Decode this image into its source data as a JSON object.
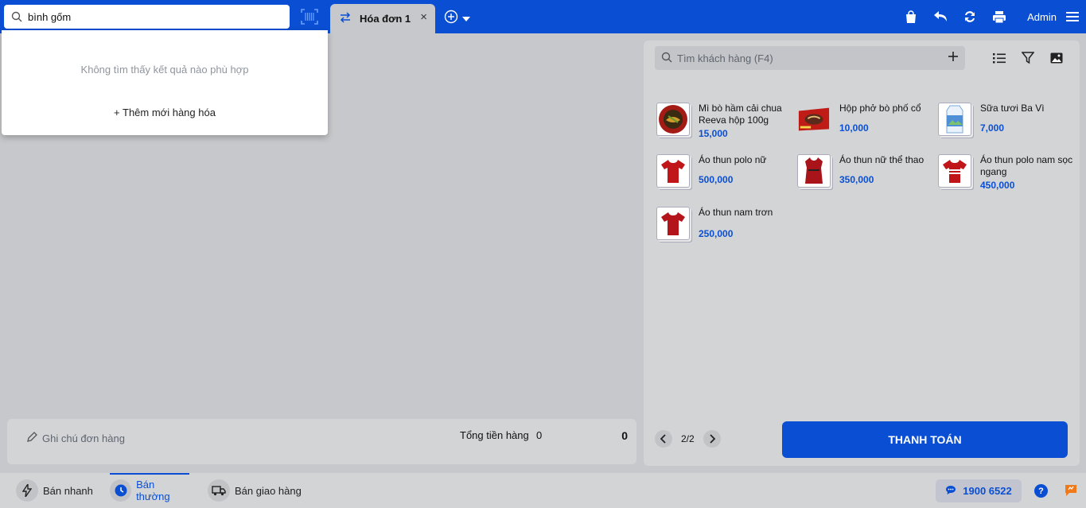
{
  "search": {
    "value": "bình gốm",
    "placeholder": ""
  },
  "tabs": [
    {
      "label": "Hóa đơn 1",
      "close": "×"
    }
  ],
  "header": {
    "user": "Admin"
  },
  "dropdown": {
    "no_results": "Không tìm thấy kết quả nào phù hợp",
    "add_new": "+ Thêm mới hàng hóa"
  },
  "customer_search": {
    "placeholder": "Tìm khách hàng (F4)"
  },
  "products": [
    {
      "name": "Mì bò hầm cải chua Reeva hộp 100g",
      "price": "15,000",
      "icon": "noodle-bowl"
    },
    {
      "name": "Hộp phở bò phố cổ",
      "price": "10,000",
      "icon": "pho-box"
    },
    {
      "name": "Sữa tươi Ba Vì",
      "price": "7,000",
      "icon": "milk-carton"
    },
    {
      "name": "Áo thun polo nữ",
      "price": "500,000",
      "icon": "red-shirt"
    },
    {
      "name": "Áo thun nữ thể thao",
      "price": "350,000",
      "icon": "red-sport-shirt"
    },
    {
      "name": "Áo thun polo nam sọc ngang",
      "price": "450,000",
      "icon": "striped-shirt"
    },
    {
      "name": "Áo thun nam trơn",
      "price": "250,000",
      "icon": "red-shirt"
    }
  ],
  "pagination": {
    "label": "2/2"
  },
  "pay_button": {
    "label": "THANH TOÁN"
  },
  "order": {
    "note_placeholder": "Ghi chú đơn hàng",
    "total_label": "Tổng tiền hàng",
    "total_count": "0",
    "total_amount": "0"
  },
  "footer": {
    "modes": [
      {
        "label": "Bán nhanh"
      },
      {
        "label": "Bán thường"
      },
      {
        "label": "Bán giao hàng"
      }
    ],
    "hotline": "1900 6522",
    "help": "?"
  },
  "colors": {
    "primary": "#0a4fd3",
    "background": "#c7c8cb",
    "panel": "#d3d4d6",
    "price": "#0a4fd3"
  }
}
